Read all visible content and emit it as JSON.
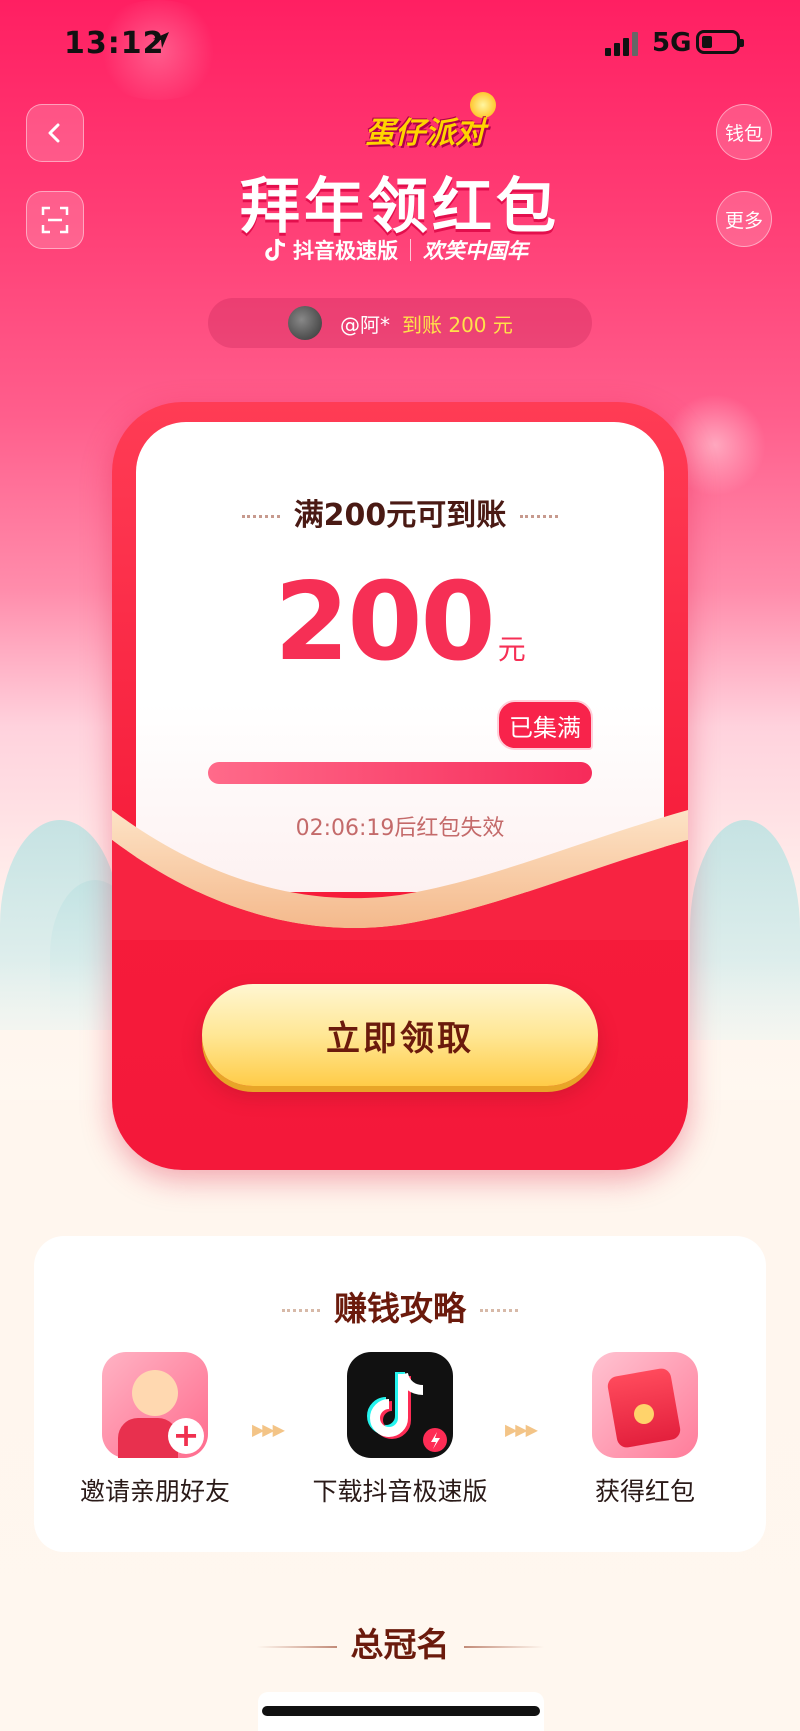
{
  "status_bar": {
    "time": "13:12",
    "network": "5G"
  },
  "header": {
    "back_icon": "chevron-left-icon",
    "scan_icon": "scan-icon",
    "wallet_label": "钱包",
    "more_label": "更多",
    "party_logo": "蛋仔派对",
    "title": "拜年领红包",
    "brand": "抖音极速版",
    "slogan": "欢笑中国年"
  },
  "notice": {
    "user": "@阿*",
    "credited": "到账 200 元"
  },
  "envelope": {
    "threshold_text": "满200元可到账",
    "amount": "200",
    "unit": "元",
    "badge": "已集满",
    "progress": 1.0,
    "countdown": "02:06:19后红包失效",
    "claim_label": "立即领取"
  },
  "strategy": {
    "title": "赚钱攻略",
    "steps": [
      {
        "label": "邀请亲朋好友",
        "icon": "invite-friend-icon"
      },
      {
        "label": "下载抖音极速版",
        "icon": "douyin-lite-app-icon"
      },
      {
        "label": "获得红包",
        "icon": "red-packet-icon"
      }
    ]
  },
  "sponsor": {
    "title": "总冠名"
  },
  "colors": {
    "primary_red": "#f62f55",
    "gold": "#ffcc48",
    "text_brown": "#6b1a0c"
  }
}
